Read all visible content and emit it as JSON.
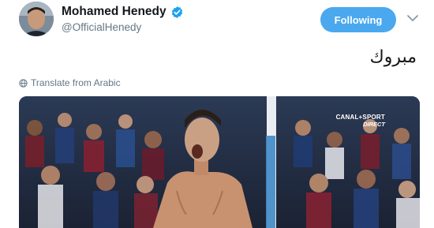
{
  "tweet": {
    "display_name": "Mohamed Henedy",
    "handle": "@OfficialHenedy",
    "follow_button_label": "Following",
    "text": "مبروك",
    "translate_label": "Translate from Arabic",
    "accent_color": "#4aa8ef"
  },
  "media": {
    "broadcast_logo": {
      "line1": "CANAL+SPORT",
      "line2": "DIRECT"
    }
  }
}
